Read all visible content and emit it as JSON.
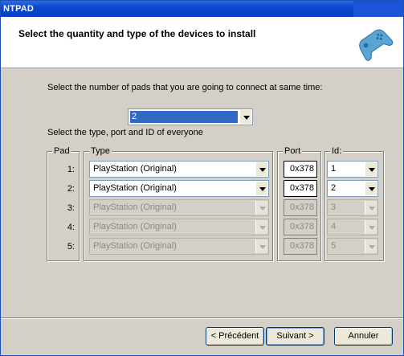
{
  "window": {
    "title": "NTPAD"
  },
  "header": {
    "title": "Select the quantity and type of the devices to install",
    "icon": "gamepad-icon"
  },
  "quantity": {
    "prompt": "Select the number of pads that you are going to connect at same time:",
    "value": "2"
  },
  "type_prompt": "Select the type, port and ID of everyone",
  "groups": {
    "pad": "Pad",
    "type": "Type",
    "port": "Port",
    "id": "Id:"
  },
  "rows": [
    {
      "num": "1:",
      "type": "PlayStation (Original)",
      "port": "0x378",
      "id": "1",
      "enabled": true
    },
    {
      "num": "2:",
      "type": "PlayStation (Original)",
      "port": "0x378",
      "id": "2",
      "enabled": true
    },
    {
      "num": "3:",
      "type": "PlayStation (Original)",
      "port": "0x378",
      "id": "3",
      "enabled": false
    },
    {
      "num": "4:",
      "type": "PlayStation (Original)",
      "port": "0x378",
      "id": "4",
      "enabled": false
    },
    {
      "num": "5:",
      "type": "PlayStation (Original)",
      "port": "0x378",
      "id": "5",
      "enabled": false
    }
  ],
  "buttons": {
    "back": "< Précédent",
    "next": "Suivant >",
    "cancel": "Annuler"
  }
}
